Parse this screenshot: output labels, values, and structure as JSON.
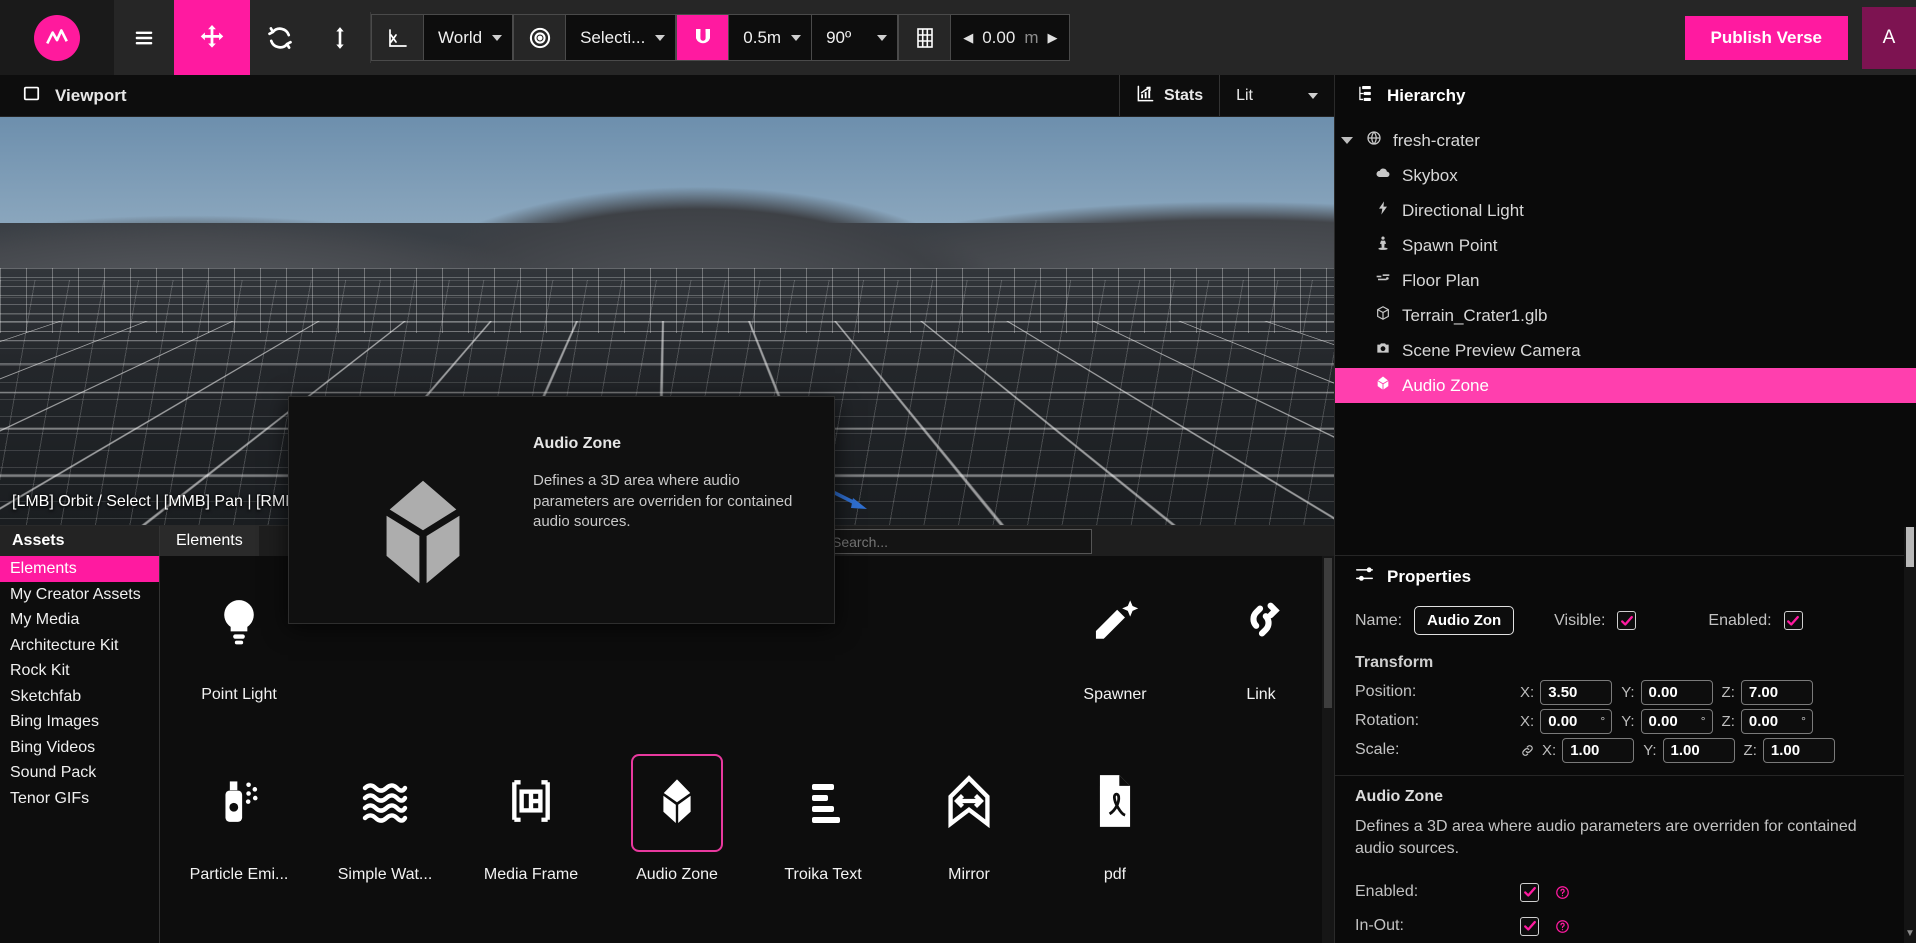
{
  "toolbar": {
    "logo_icon": "wave-logo-icon",
    "menu_icon": "hamburger-menu-icon",
    "move_tool_icon": "move-tool-icon",
    "rotate_tool_icon": "rotate-tool-icon",
    "scale_tool_icon": "scale-tool-icon",
    "axis_icon": "axis-gizmo-icon",
    "coordinate_space": "World",
    "pivot_icon": "pivot-target-icon",
    "pivot_mode": "Selecti...",
    "snap_icon": "magnet-icon",
    "snap_distance": "0.5m",
    "snap_angle": "90º",
    "grid_icon": "grid-icon",
    "grid_height": "0.00",
    "grid_unit": "m",
    "grid_prev_icon": "arrow-left-icon",
    "grid_next_icon": "arrow-right-icon",
    "publish_label": "Publish Verse",
    "avatar_label": "A"
  },
  "viewport": {
    "panel_icon": "viewport-panel-icon",
    "title": "Viewport",
    "stats_icon": "stats-chart-icon",
    "stats_label": "Stats",
    "shading_mode": "Lit",
    "hint": "[LMB] Orbit / Select | [MMB] Pan | [RMB"
  },
  "tooltip": {
    "icon": "cube-icon",
    "title": "Audio Zone",
    "description": "Defines a 3D area where audio parameters are overriden for contained audio sources."
  },
  "assets": {
    "header": "Assets",
    "categories": [
      {
        "label": "Elements",
        "selected": true
      },
      {
        "label": "My Creator Assets",
        "selected": false
      },
      {
        "label": "My Media",
        "selected": false
      },
      {
        "label": "Architecture Kit",
        "selected": false
      },
      {
        "label": "Rock Kit",
        "selected": false
      },
      {
        "label": "Sketchfab",
        "selected": false
      },
      {
        "label": "Bing Images",
        "selected": false
      },
      {
        "label": "Bing Videos",
        "selected": false
      },
      {
        "label": "Sound Pack",
        "selected": false
      },
      {
        "label": "Tenor GIFs",
        "selected": false
      }
    ],
    "tab_label": "Elements",
    "search_placeholder": "Search...",
    "search_value": "",
    "items": [
      {
        "label": "Point Light",
        "icon": "point-light-icon",
        "selected": false
      },
      {
        "label": "Spawner",
        "icon": "spawner-icon",
        "selected": false
      },
      {
        "label": "Link",
        "icon": "link-icon",
        "selected": false
      },
      {
        "label": "Particle Emi...",
        "icon": "particle-emitter-icon",
        "selected": false
      },
      {
        "label": "Simple Wat...",
        "icon": "water-waves-icon",
        "selected": false
      },
      {
        "label": "Media Frame",
        "icon": "media-frame-icon",
        "selected": false
      },
      {
        "label": "Audio Zone",
        "icon": "audio-zone-icon",
        "selected": true
      },
      {
        "label": "Troika Text",
        "icon": "text-lines-icon",
        "selected": false
      },
      {
        "label": "Mirror",
        "icon": "mirror-icon",
        "selected": false
      },
      {
        "label": "pdf",
        "icon": "pdf-file-icon",
        "selected": false
      }
    ]
  },
  "hierarchy": {
    "icon": "hierarchy-icon",
    "title": "Hierarchy",
    "items": [
      {
        "label": "fresh-crater",
        "icon": "globe-icon",
        "level": "root",
        "selected": false
      },
      {
        "label": "Skybox",
        "icon": "cloud-icon",
        "level": "child",
        "selected": false
      },
      {
        "label": "Directional Light",
        "icon": "bolt-icon",
        "level": "child",
        "selected": false
      },
      {
        "label": "Spawn Point",
        "icon": "spawn-point-icon",
        "level": "child",
        "selected": false
      },
      {
        "label": "Floor Plan",
        "icon": "floor-plan-icon",
        "level": "child",
        "selected": false
      },
      {
        "label": "Terrain_Crater1.glb",
        "icon": "cube-icon",
        "level": "child",
        "selected": false
      },
      {
        "label": "Scene Preview Camera",
        "icon": "camera-icon",
        "level": "child",
        "selected": false
      },
      {
        "label": "Audio Zone",
        "icon": "cube-icon",
        "level": "child",
        "selected": true
      }
    ]
  },
  "properties": {
    "icon": "sliders-icon",
    "title": "Properties",
    "name_label": "Name:",
    "name_value": "Audio Zon",
    "visible_label": "Visible:",
    "visible_checked": true,
    "enabled_label": "Enabled:",
    "enabled_checked": true,
    "transform": {
      "title": "Transform",
      "position_label": "Position:",
      "rotation_label": "Rotation:",
      "scale_label": "Scale:",
      "axis_x": "X:",
      "axis_y": "Y:",
      "axis_z": "Z:",
      "link_icon": "link-chain-icon",
      "position": {
        "x": "3.50",
        "y": "0.00",
        "z": "7.00"
      },
      "rotation": {
        "x": "0.00",
        "y": "0.00",
        "z": "0.00"
      },
      "scale": {
        "x": "1.00",
        "y": "1.00",
        "z": "1.00"
      }
    },
    "audio_zone": {
      "title": "Audio Zone",
      "description": "Defines a 3D area where audio parameters are overriden for contained audio sources.",
      "enabled_label": "Enabled:",
      "enabled_checked": true,
      "inout_label": "In-Out:",
      "inout_checked": true,
      "help_icon": "help-circle-icon"
    }
  },
  "colors": {
    "accent": "#ff1aa0",
    "selection": "#ff3fae",
    "panel_bg": "#0a0a0a",
    "toolbar_bg": "#262626"
  }
}
